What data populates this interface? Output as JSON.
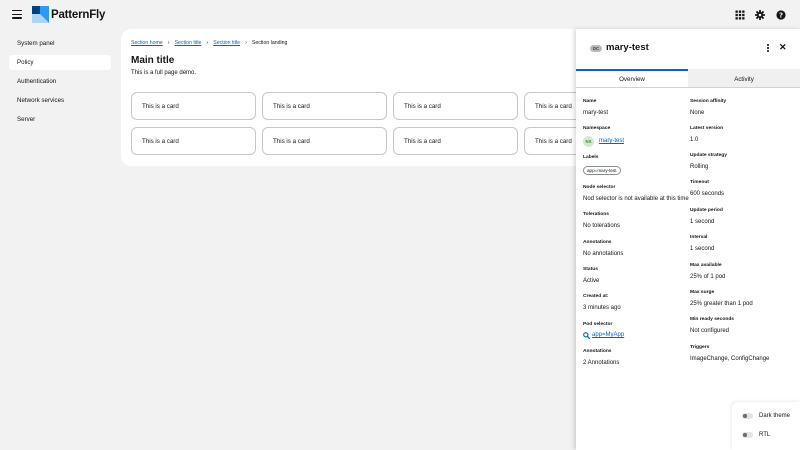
{
  "brand": {
    "name": "PatternFly"
  },
  "sidebar": {
    "items": [
      {
        "label": "System panel"
      },
      {
        "label": "Policy"
      },
      {
        "label": "Authentication"
      },
      {
        "label": "Network services"
      },
      {
        "label": "Server"
      }
    ]
  },
  "main": {
    "breadcrumb": [
      "Section home",
      "Section title",
      "Section title",
      "Section landing"
    ],
    "title": "Main title",
    "description": "This is a full page demo.",
    "card_label": "This is a card"
  },
  "drawer": {
    "badge": "DC",
    "title": "mary-test",
    "tabs": [
      "Overview",
      "Activity"
    ],
    "left": {
      "name_label": "Name",
      "name_value": "mary-test",
      "namespace_label": "Namespace",
      "namespace_badge": "NS",
      "namespace_value": "mary-test",
      "labels_label": "Labels",
      "labels_chip": "app=mary-test",
      "node_selector_label": "Node selector",
      "node_selector_value": "Nod selector is not available at this time",
      "tolerations_label": "Tolerations",
      "tolerations_value": "No tolerations",
      "annotations_label": "Annotations",
      "annotations_value": "No annotations",
      "status_label": "Status",
      "status_value": "Active",
      "created_label": "Created at:",
      "created_value": "3 minutes ago",
      "pod_selector_label": "Pod selector",
      "pod_selector_value": "app=MyApp",
      "annotations2_label": "Annotations",
      "annotations2_value": "2 Annotations"
    },
    "right": {
      "affinity_label": "Session affinity",
      "affinity_value": "None",
      "version_label": "Latest version",
      "version_value": "1.0",
      "strategy_label": "Update strategy",
      "strategy_value": "Rolling",
      "timeout_label": "Timeout",
      "timeout_value": "600 seconds",
      "period_label": "Update period",
      "period_value": "1 second",
      "interval_label": "Interval",
      "interval_value": "1 second",
      "max_available_label": "Max available",
      "max_available_value": "25% of 1 pod",
      "max_surge_label": "Max surge",
      "max_surge_value": "25% greater than 1 pod",
      "min_ready_label": "Min ready seconds",
      "min_ready_value": "Not configured",
      "triggers_label": "Triggers",
      "triggers_value": "ImageChange, ConfigChange"
    }
  },
  "switcher": {
    "dark_theme": "Dark theme",
    "rtl": "RTL"
  },
  "colors": {
    "link": "#0066cc",
    "background": "#f2f2f2",
    "surface": "#ffffff"
  }
}
